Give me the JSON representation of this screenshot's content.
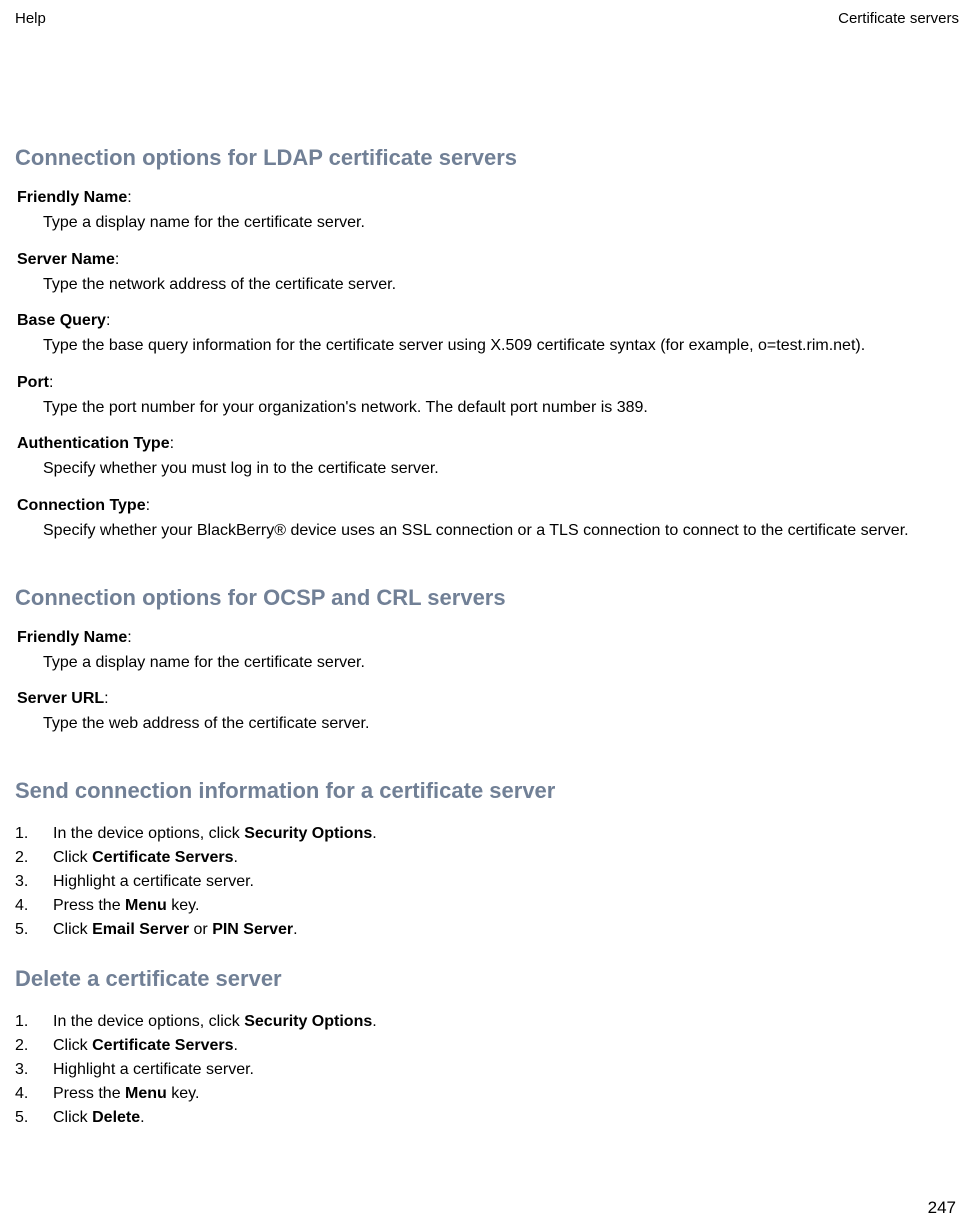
{
  "header": {
    "left": "Help",
    "right": "Certificate servers"
  },
  "section1": {
    "heading": "Connection options for LDAP certificate servers",
    "items": [
      {
        "term": "Friendly Name",
        "desc": "Type a display name for the certificate server."
      },
      {
        "term": "Server Name",
        "desc": "Type the network address of the certificate server."
      },
      {
        "term": "Base Query",
        "desc": "Type the base query information for the certificate server using X.509 certificate syntax (for example, o=test.rim.net)."
      },
      {
        "term": "Port",
        "desc": "Type the port number for your organization's network. The default port number is 389."
      },
      {
        "term": "Authentication Type",
        "desc": "Specify whether you must log in to the certificate server."
      },
      {
        "term": "Connection Type",
        "desc": "Specify whether your BlackBerry® device uses an SSL connection or a TLS connection to connect to the certificate server."
      }
    ]
  },
  "section2": {
    "heading": "Connection options for OCSP and CRL servers",
    "items": [
      {
        "term": "Friendly Name",
        "desc": "Type a display name for the certificate server."
      },
      {
        "term": "Server URL",
        "desc": "Type the web address of the certificate server."
      }
    ]
  },
  "section3": {
    "heading": "Send connection information for a certificate server",
    "steps": {
      "s1a": "In the device options, click ",
      "s1b": "Security Options",
      "s2a": "Click ",
      "s2b": "Certificate Servers",
      "s3a": "Highlight a certificate server.",
      "s4a": "Press the ",
      "s4b": "Menu",
      "s4c": " key.",
      "s5a": "Click ",
      "s5b": "Email Server",
      "s5c": " or ",
      "s5d": "PIN Server"
    }
  },
  "section4": {
    "heading": "Delete a certificate server",
    "steps": {
      "s1a": "In the device options, click ",
      "s1b": "Security Options",
      "s2a": "Click ",
      "s2b": "Certificate Servers",
      "s3a": "Highlight a certificate server.",
      "s4a": "Press the ",
      "s4b": "Menu",
      "s4c": " key.",
      "s5a": "Click ",
      "s5b": "Delete"
    }
  },
  "pageNumber": "247"
}
